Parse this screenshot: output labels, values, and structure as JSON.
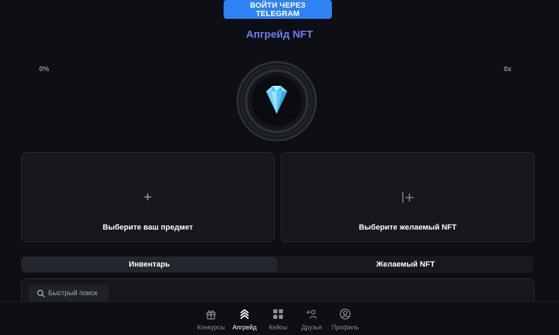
{
  "header": {
    "login_button": "ВОЙТИ ЧЕРЕЗ TELEGRAM",
    "title": "Апгрейд NFT"
  },
  "upgrade": {
    "chance_percent": "0%",
    "multiplier": "0x",
    "center_icon": "diamond-icon"
  },
  "cards": {
    "left": {
      "icon": "plus-icon",
      "label": "Выберите ваш предмет"
    },
    "right": {
      "icon": "plus-cursor-icon",
      "label": "Выберите желаемый NFT"
    }
  },
  "tabs": [
    {
      "label": "Инвентарь",
      "active": true
    },
    {
      "label": "Желаемый NFT",
      "active": false
    }
  ],
  "search": {
    "placeholder": "Быстрый поиск"
  },
  "bottom_nav": [
    {
      "label": "Конкурсы",
      "icon": "gift-icon",
      "active": false
    },
    {
      "label": "Апгрейд",
      "icon": "chevrons-up-icon",
      "active": true
    },
    {
      "label": "Кейсы",
      "icon": "grid-icon",
      "active": false
    },
    {
      "label": "Друзья",
      "icon": "add-user-icon",
      "active": false
    },
    {
      "label": "Профиль",
      "icon": "profile-icon",
      "active": false
    }
  ],
  "colors": {
    "background": "#0d0f14",
    "accent_blue": "#2e82f4",
    "title_purple": "#6f7cf2",
    "card_bg": "#15171c",
    "diamond": "#5fd3f5"
  }
}
